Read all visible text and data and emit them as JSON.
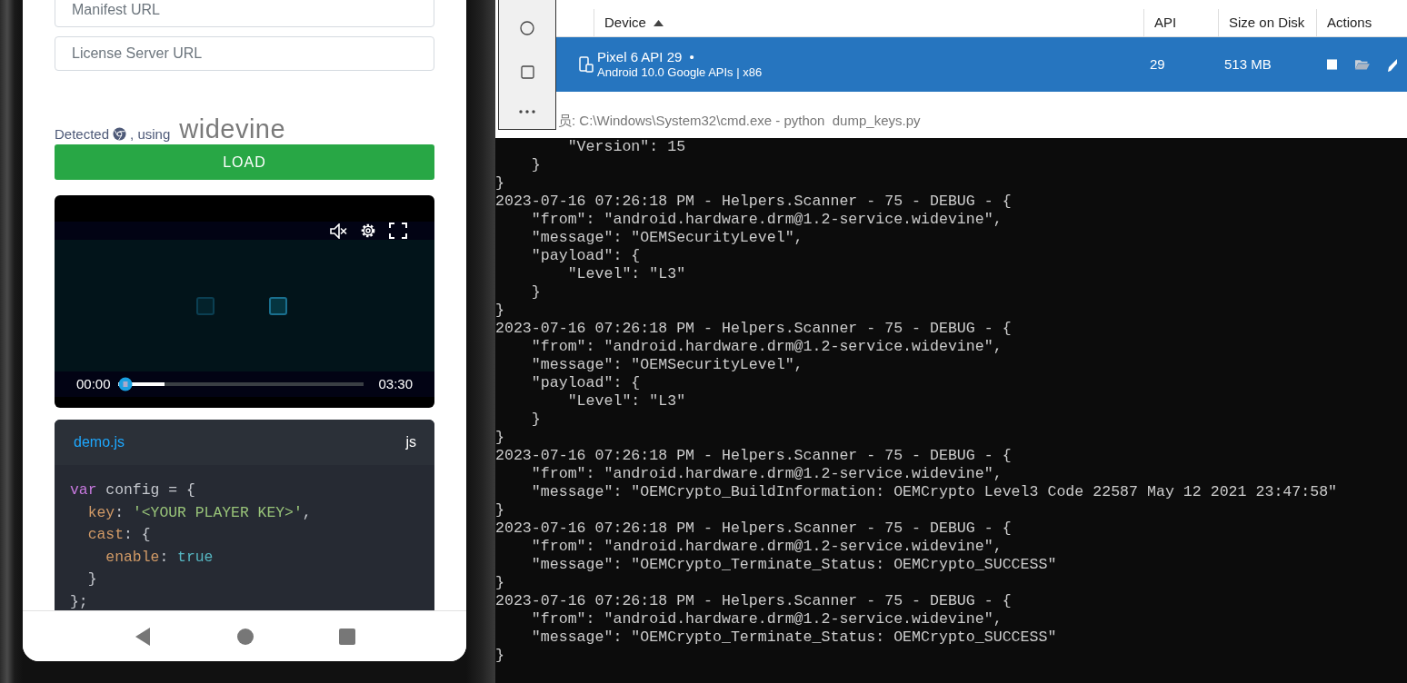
{
  "phone": {
    "fields": [
      {
        "placeholder": "Manifest URL"
      },
      {
        "placeholder": "License Server URL"
      }
    ],
    "detected": {
      "prefix": "Detected",
      "suffix": ", using",
      "drm": "widevine"
    },
    "load_button": "LOAD",
    "player": {
      "muted": true,
      "current_time": "00:00",
      "duration": "03:30",
      "level": 0.19
    },
    "code_card": {
      "filename": "demo.js",
      "language": "js",
      "lines": [
        [
          {
            "kind": "keyword",
            "text": "var"
          },
          {
            "kind": "plain",
            "text": " config = {"
          }
        ],
        [
          {
            "kind": "property",
            "text": "  key"
          },
          {
            "kind": "plain",
            "text": ": "
          },
          {
            "kind": "string",
            "text": "'<YOUR PLAYER KEY>'"
          },
          {
            "kind": "plain",
            "text": ","
          }
        ],
        [
          {
            "kind": "property",
            "text": "  cast"
          },
          {
            "kind": "plain",
            "text": ": {"
          }
        ],
        [
          {
            "kind": "property",
            "text": "    enable"
          },
          {
            "kind": "plain",
            "text": ": "
          },
          {
            "kind": "literal",
            "text": "true"
          }
        ],
        [
          {
            "kind": "plain",
            "text": "  }"
          }
        ],
        [
          {
            "kind": "plain",
            "text": "};"
          }
        ]
      ]
    }
  },
  "device_manager": {
    "columns": [
      {
        "label": "Device",
        "sorted": true
      },
      {
        "label": "API",
        "sorted": false
      },
      {
        "label": "Size on Disk",
        "sorted": false
      },
      {
        "label": "Actions",
        "sorted": false
      }
    ],
    "devices": [
      {
        "name": "Pixel 6 API 29",
        "status": "•",
        "details": "Android 10.0 Google APIs | x86",
        "api": "29",
        "size": "513 MB",
        "selected": true,
        "running": true
      }
    ]
  },
  "terminal": {
    "title": "员: C:\\Windows\\System32\\cmd.exe - python  dump_keys.py",
    "lines": [
      "        \"Version\": 15",
      "    }",
      "}",
      "2023-07-16 07:26:18 PM - Helpers.Scanner - 75 - DEBUG - {",
      "    \"from\": \"android.hardware.drm@1.2-service.widevine\",",
      "    \"message\": \"OEMSecurityLevel\",",
      "    \"payload\": {",
      "        \"Level\": \"L3\"",
      "    }",
      "}",
      "2023-07-16 07:26:18 PM - Helpers.Scanner - 75 - DEBUG - {",
      "    \"from\": \"android.hardware.drm@1.2-service.widevine\",",
      "    \"message\": \"OEMSecurityLevel\",",
      "    \"payload\": {",
      "        \"Level\": \"L3\"",
      "    }",
      "}",
      "2023-07-16 07:26:18 PM - Helpers.Scanner - 75 - DEBUG - {",
      "    \"from\": \"android.hardware.drm@1.2-service.widevine\",",
      "    \"message\": \"OEMCrypto_BuildInformation: OEMCrypto Level3 Code 22587 May 12 2021 23:47:58\"",
      "}",
      "2023-07-16 07:26:18 PM - Helpers.Scanner - 75 - DEBUG - {",
      "    \"from\": \"android.hardware.drm@1.2-service.widevine\",",
      "    \"message\": \"OEMCrypto_Terminate_Status: OEMCrypto_SUCCESS\"",
      "}",
      "2023-07-16 07:26:18 PM - Helpers.Scanner - 75 - DEBUG - {",
      "    \"from\": \"android.hardware.drm@1.2-service.widevine\",",
      "    \"message\": \"OEMCrypto_Terminate_Status: OEMCrypto_SUCCESS\"",
      "}"
    ]
  }
}
